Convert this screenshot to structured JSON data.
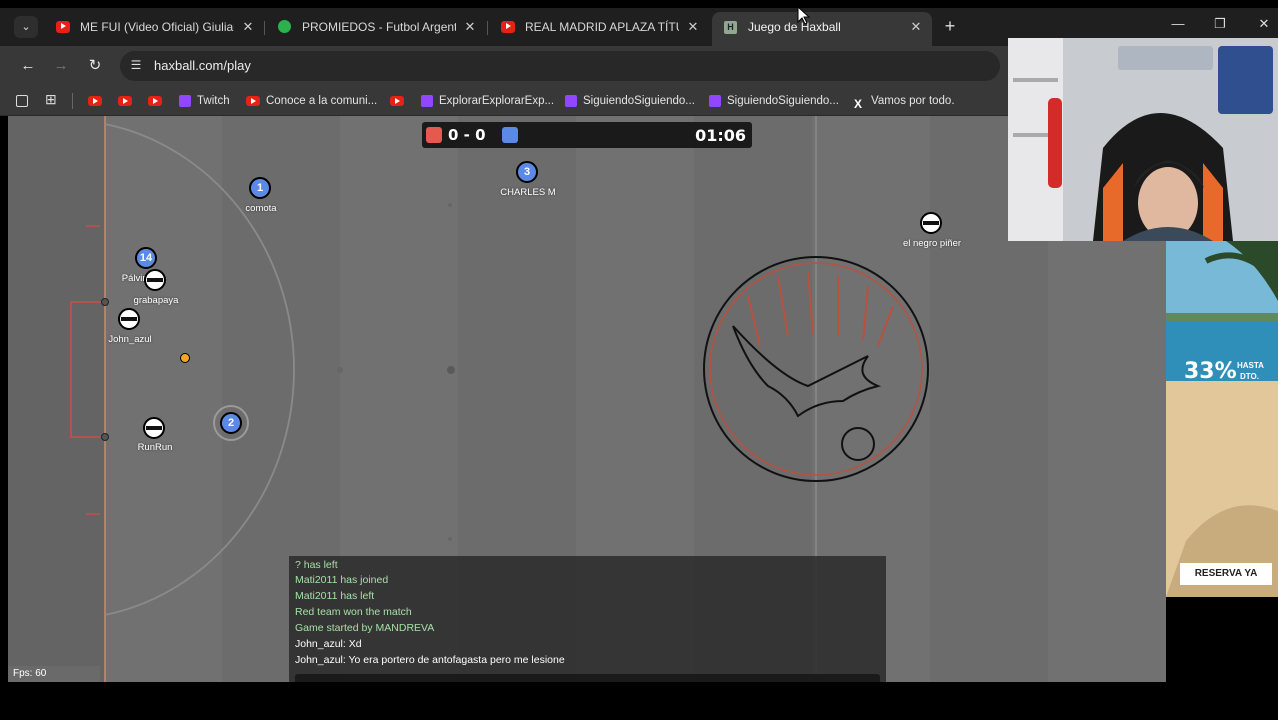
{
  "tabs": [
    {
      "title": "ME FUI (Video Oficial) Giuliano",
      "icon": "youtube-icon"
    },
    {
      "title": "PROMIEDOS - Futbol Argentino",
      "icon": "promiedos-icon"
    },
    {
      "title": "REAL MADRID APLAZA TÍTULO",
      "icon": "youtube-icon"
    },
    {
      "title": "Juego de Haxball",
      "icon": "haxball-icon",
      "active": true
    }
  ],
  "tab_close_glyph": "✕",
  "new_tab_glyph": "+",
  "window_controls": {
    "minimize": "—",
    "restore": "❐",
    "close": "✕"
  },
  "address_bar": {
    "url": "haxball.com/play"
  },
  "nav": {
    "back": "←",
    "forward": "→",
    "reload": "↻"
  },
  "bookmarks": [
    {
      "label": "",
      "icon": "youtube-icon"
    },
    {
      "label": "",
      "icon": "youtube-icon"
    },
    {
      "label": "",
      "icon": "youtube-icon"
    },
    {
      "label": "Twitch",
      "icon": "twitch-icon"
    },
    {
      "label": "Conoce a la comuni...",
      "icon": "youtube-icon"
    },
    {
      "label": "",
      "icon": "youtube-icon"
    },
    {
      "label": "ExplorarExplorarExp...",
      "icon": "twitch-icon"
    },
    {
      "label": "SiguiendoSiguiendo...",
      "icon": "twitch-icon"
    },
    {
      "label": "SiguiendoSiguiendo...",
      "icon": "twitch-icon"
    },
    {
      "label": "Vamos por todo.",
      "icon": "x-icon"
    }
  ],
  "scoreboard": {
    "red": 0,
    "blue": 0,
    "score_text": "0 - 0",
    "timer": "01:06",
    "red_color": "#e55a4f",
    "blue_color": "#5b8ae6"
  },
  "players": [
    {
      "name": "comota",
      "number": "1",
      "team": "blue"
    },
    {
      "name": "CHARLES M",
      "number": "3",
      "team": "blue"
    },
    {
      "name": "Pálvim",
      "number": "14",
      "team": "blue"
    },
    {
      "name": "grabapaya",
      "number": "",
      "team": "white"
    },
    {
      "name": "John_azul",
      "number": "",
      "team": "white"
    },
    {
      "name": "RunRun",
      "number": "",
      "team": "white"
    },
    {
      "name": "",
      "number": "2",
      "team": "blue"
    },
    {
      "name": "el negro piñer",
      "number": "",
      "team": "white"
    }
  ],
  "chat": {
    "lines": [
      {
        "text": "? has left",
        "kind": "system"
      },
      {
        "text": "Mati2011 has joined",
        "kind": "system"
      },
      {
        "text": "Mati2011 has left",
        "kind": "system"
      },
      {
        "text": "Red team won the match",
        "kind": "system"
      },
      {
        "text": "Game started by MANDREVA",
        "kind": "system"
      },
      {
        "text": "John_azul: Xd",
        "kind": "message"
      },
      {
        "text": "John_azul: Yo era portero de antofagasta pero me lesione",
        "kind": "message"
      }
    ]
  },
  "fps": "Fps: 60",
  "ad": {
    "percent": "33%",
    "hasta": "HASTA",
    "dto": "DTO.",
    "cta": "RESERVA YA"
  }
}
